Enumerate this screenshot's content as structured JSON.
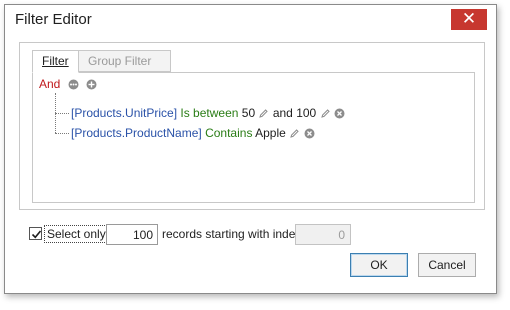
{
  "window": {
    "title": "Filter Editor",
    "close_glyph": "✕"
  },
  "tabs": [
    {
      "label": "Filter",
      "active": true
    },
    {
      "label": "Group Filter",
      "active": false
    }
  ],
  "filter_tree": {
    "root_operator": "And",
    "conditions": [
      {
        "field": "[Products.UnitPrice]",
        "operator": "Is between",
        "value1": "50",
        "connector": "and",
        "value2": "100"
      },
      {
        "field": "[Products.ProductName]",
        "operator": "Contains",
        "value1": "Apple"
      }
    ]
  },
  "options": {
    "select_only_label": "Select only",
    "select_only_checked": true,
    "count_value": "100",
    "records_label": "records starting with index",
    "index_value": "0"
  },
  "buttons": {
    "ok": "OK",
    "cancel": "Cancel"
  },
  "icons": {
    "group_menu": "ellipsis-circle-icon",
    "add": "plus-circle-icon",
    "edit": "pencil-icon",
    "remove": "remove-circle-icon"
  },
  "colors": {
    "operator_group": "#c0191c",
    "field": "#2a52a8",
    "condition_operator": "#2a7d16",
    "close_button": "#c7372f"
  }
}
